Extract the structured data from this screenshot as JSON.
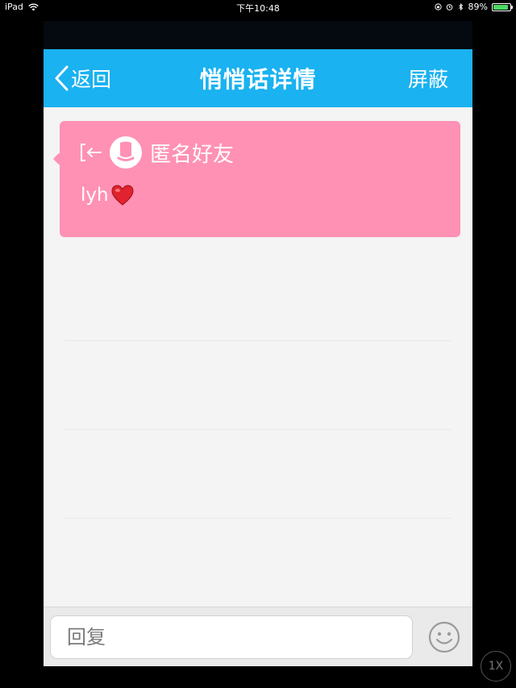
{
  "status_bar": {
    "device": "iPad",
    "time": "下午10:48",
    "battery_percent": "89%",
    "battery_level": 0.89
  },
  "nav": {
    "back_label": "返回",
    "title": "悄悄话详情",
    "action_label": "屏蔽",
    "bar_color": "#1ab2f0"
  },
  "message": {
    "sender": "匿名好友",
    "text": "lyh",
    "card_color": "#ff91b4",
    "icons": [
      "exit-icon",
      "avatar-icon",
      "heart-icon"
    ]
  },
  "reply": {
    "placeholder": "回复"
  },
  "bottom": {
    "emoji_icon": "smiley-icon"
  },
  "overlay": {
    "speed_badge": "1X"
  }
}
